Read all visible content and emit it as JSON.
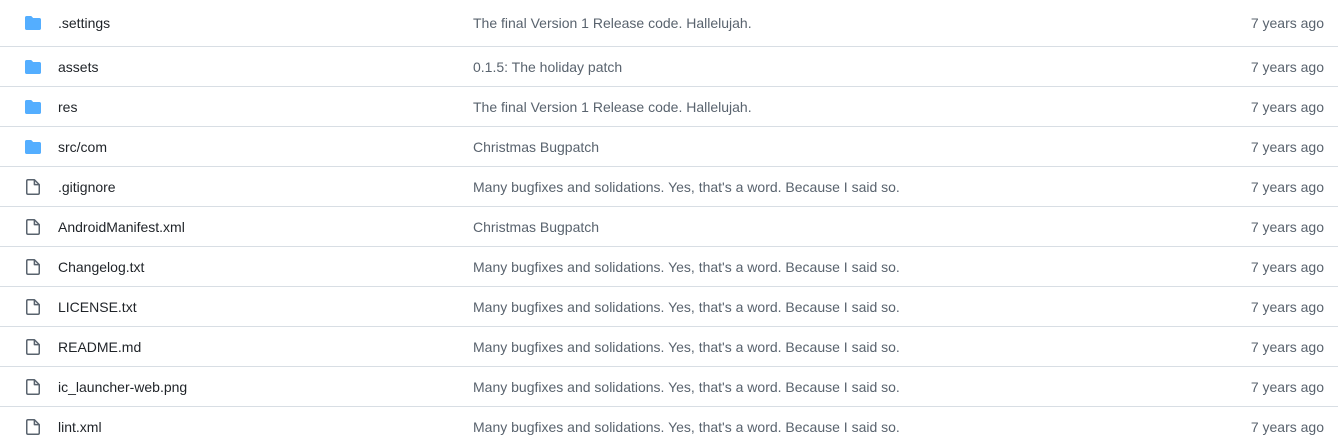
{
  "colors": {
    "folder_icon": "#54aeff",
    "file_icon": "#59636e",
    "text_primary": "#1f2328",
    "text_muted": "#59636e",
    "divider": "#d8dee4"
  },
  "files": [
    {
      "type": "folder",
      "icon": "folder-icon",
      "name": ".settings",
      "message": "The final Version 1 Release code. Hallelujah.",
      "age": "7 years ago"
    },
    {
      "type": "folder",
      "icon": "folder-icon",
      "name": "assets",
      "message": "0.1.5: The holiday patch",
      "age": "7 years ago"
    },
    {
      "type": "folder",
      "icon": "folder-icon",
      "name": "res",
      "message": "The final Version 1 Release code. Hallelujah.",
      "age": "7 years ago"
    },
    {
      "type": "folder",
      "icon": "folder-icon",
      "name": "src/com",
      "message": "Christmas Bugpatch",
      "age": "7 years ago"
    },
    {
      "type": "file",
      "icon": "file-icon",
      "name": ".gitignore",
      "message": "Many bugfixes and solidations. Yes, that's a word. Because I said so.",
      "age": "7 years ago"
    },
    {
      "type": "file",
      "icon": "file-icon",
      "name": "AndroidManifest.xml",
      "message": "Christmas Bugpatch",
      "age": "7 years ago"
    },
    {
      "type": "file",
      "icon": "file-icon",
      "name": "Changelog.txt",
      "message": "Many bugfixes and solidations. Yes, that's a word. Because I said so.",
      "age": "7 years ago"
    },
    {
      "type": "file",
      "icon": "file-icon",
      "name": "LICENSE.txt",
      "message": "Many bugfixes and solidations. Yes, that's a word. Because I said so.",
      "age": "7 years ago"
    },
    {
      "type": "file",
      "icon": "file-icon",
      "name": "README.md",
      "message": "Many bugfixes and solidations. Yes, that's a word. Because I said so.",
      "age": "7 years ago"
    },
    {
      "type": "file",
      "icon": "file-icon",
      "name": "ic_launcher-web.png",
      "message": "Many bugfixes and solidations. Yes, that's a word. Because I said so.",
      "age": "7 years ago"
    },
    {
      "type": "file",
      "icon": "file-icon",
      "name": "lint.xml",
      "message": "Many bugfixes and solidations. Yes, that's a word. Because I said so.",
      "age": "7 years ago"
    }
  ]
}
